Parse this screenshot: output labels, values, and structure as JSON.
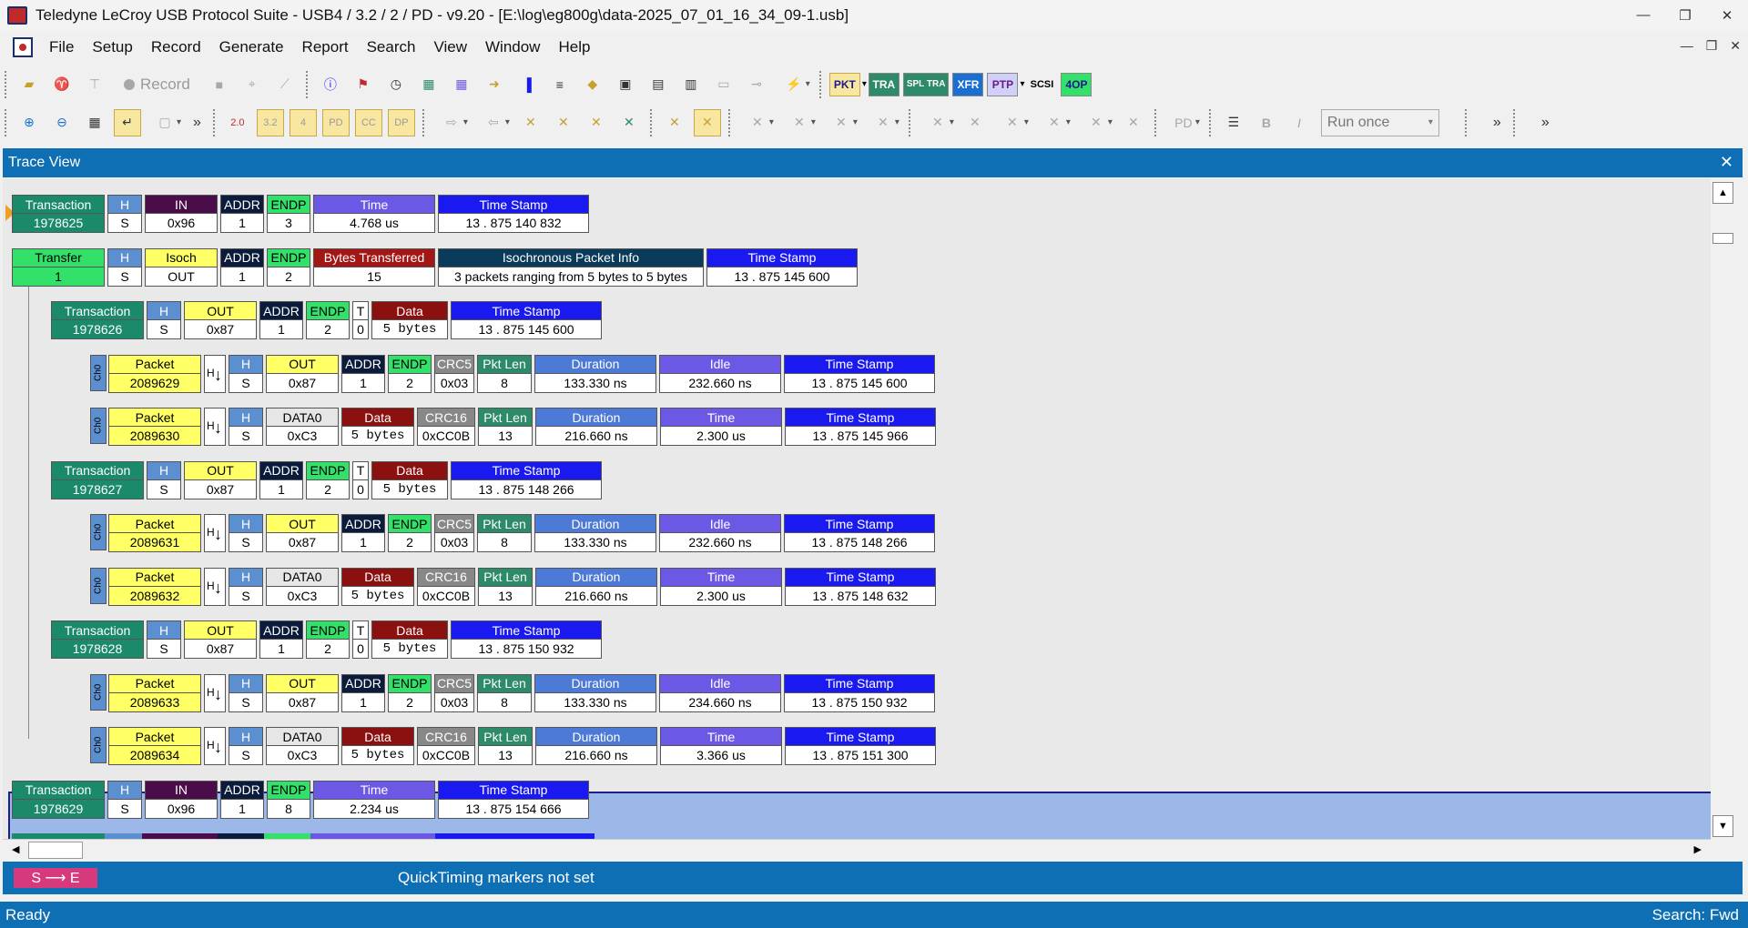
{
  "window": {
    "title": "Teledyne LeCroy USB Protocol Suite - USB4 / 3.2 / 2 / PD - v9.20 - [E:\\log\\eg800g\\data-2025_07_01_16_34_09-1.usb]",
    "min_icon": "minimize-icon",
    "restore_icon": "restore-icon",
    "close_icon": "close-icon"
  },
  "menu": [
    "File",
    "Setup",
    "Record",
    "Generate",
    "Report",
    "Search",
    "View",
    "Window",
    "Help"
  ],
  "toolbar1": {
    "record_label": "Record",
    "protocol_buttons": [
      "PKT",
      "TRA",
      "SPL TRA",
      "XFR",
      "PTP",
      "SCSI",
      "4OP"
    ]
  },
  "toolbar2": {
    "run_mode": "Run once",
    "chevron": "»"
  },
  "trace_view": {
    "title": "Trace View",
    "close": "✕"
  },
  "quicktiming": {
    "se_label": "S ⟶ E",
    "message": "QuickTiming markers not set"
  },
  "status": {
    "left": "Ready",
    "right": "Search: Fwd"
  },
  "rows": [
    {
      "kind": "transaction",
      "indent": 0,
      "cells": [
        {
          "c": "c-trans",
          "h": "Transaction",
          "v": "1978625",
          "w": 102
        },
        {
          "c": "c-hs",
          "h": "H",
          "v": "S",
          "w": 38
        },
        {
          "c": "c-in",
          "h": "IN",
          "v": "0x96",
          "w": 80
        },
        {
          "c": "c-addr",
          "h": "ADDR",
          "v": "1",
          "w": 48
        },
        {
          "c": "c-endp",
          "h": "ENDP",
          "v": "3",
          "w": 48
        },
        {
          "c": "c-time",
          "h": "Time",
          "v": "4.768 us",
          "w": 134
        },
        {
          "c": "c-ts",
          "h": "Time Stamp",
          "v": "13 . 875 140 832",
          "w": 166
        }
      ]
    },
    {
      "kind": "transfer",
      "indent": 0,
      "cells": [
        {
          "c": "c-xfer",
          "h": "Transfer",
          "v": "1",
          "w": 102
        },
        {
          "c": "c-hs",
          "h": "H",
          "v": "S",
          "w": 38
        },
        {
          "c": "c-isoch",
          "h": "Isoch",
          "v": "OUT",
          "w": 80
        },
        {
          "c": "c-addr",
          "h": "ADDR",
          "v": "1",
          "w": 48
        },
        {
          "c": "c-endp",
          "h": "ENDP",
          "v": "2",
          "w": 48
        },
        {
          "c": "c-bytes",
          "h": "Bytes Transferred",
          "v": "15",
          "w": 134
        },
        {
          "c": "c-isoinfo",
          "h": "Isochronous Packet Info",
          "v": "3 packets ranging from 5 bytes to 5 bytes",
          "w": 292
        },
        {
          "c": "c-ts",
          "h": "Time Stamp",
          "v": "13 . 875 145 600",
          "w": 166
        }
      ]
    },
    {
      "kind": "transaction",
      "indent": 1,
      "cells": [
        {
          "c": "c-trans",
          "h": "Transaction",
          "v": "1978626",
          "w": 102
        },
        {
          "c": "c-hs",
          "h": "H",
          "v": "S",
          "w": 38
        },
        {
          "c": "c-out",
          "h": "OUT",
          "v": "0x87",
          "w": 80
        },
        {
          "c": "c-addr",
          "h": "ADDR",
          "v": "1",
          "w": 48
        },
        {
          "c": "c-endp",
          "h": "ENDP",
          "v": "2",
          "w": 48
        },
        {
          "c": "c-t",
          "h": "T",
          "v": "0",
          "w": 18
        },
        {
          "c": "c-data",
          "h": "Data",
          "v": "5 bytes",
          "w": 84,
          "mono": true
        },
        {
          "c": "c-ts",
          "h": "Time Stamp",
          "v": "13 . 875 145 600",
          "w": 166
        }
      ]
    },
    {
      "kind": "packet",
      "indent": 2,
      "ch": "Ch0",
      "cells": [
        {
          "c": "c-pkt",
          "h": "Packet",
          "v": "2089629",
          "w": 102
        },
        {
          "c": "c-hs",
          "h": "H",
          "v": "S",
          "w": 38
        },
        {
          "c": "c-out",
          "h": "OUT",
          "v": "0x87",
          "w": 80
        },
        {
          "c": "c-addr",
          "h": "ADDR",
          "v": "1",
          "w": 48
        },
        {
          "c": "c-endp",
          "h": "ENDP",
          "v": "2",
          "w": 48
        },
        {
          "c": "c-crc5",
          "h": "CRC5",
          "v": "0x03",
          "w": 44
        },
        {
          "c": "c-pktlen",
          "h": "Pkt Len",
          "v": "8",
          "w": 60
        },
        {
          "c": "c-dur",
          "h": "Duration",
          "v": "133.330 ns",
          "w": 134
        },
        {
          "c": "c-idle",
          "h": "Idle",
          "v": "232.660 ns",
          "w": 134
        },
        {
          "c": "c-ts",
          "h": "Time Stamp",
          "v": "13 . 875 145 600",
          "w": 166
        }
      ]
    },
    {
      "kind": "packet",
      "indent": 2,
      "ch": "Ch0",
      "cells": [
        {
          "c": "c-pkt",
          "h": "Packet",
          "v": "2089630",
          "w": 102
        },
        {
          "c": "c-hs",
          "h": "H",
          "v": "S",
          "w": 38
        },
        {
          "c": "c-data0",
          "h": "DATA0",
          "v": "0xC3",
          "w": 80
        },
        {
          "c": "c-data",
          "h": "Data",
          "v": "5 bytes",
          "w": 80,
          "mono": true
        },
        {
          "c": "c-crc16",
          "h": "CRC16",
          "v": "0xCC0B",
          "w": 64
        },
        {
          "c": "c-pktlen",
          "h": "Pkt Len",
          "v": "13",
          "w": 60
        },
        {
          "c": "c-dur",
          "h": "Duration",
          "v": "216.660 ns",
          "w": 134
        },
        {
          "c": "c-time",
          "h": "Time",
          "v": "2.300 us",
          "w": 134
        },
        {
          "c": "c-ts",
          "h": "Time Stamp",
          "v": "13 . 875 145 966",
          "w": 166
        }
      ]
    },
    {
      "kind": "transaction",
      "indent": 1,
      "cells": [
        {
          "c": "c-trans",
          "h": "Transaction",
          "v": "1978627",
          "w": 102
        },
        {
          "c": "c-hs",
          "h": "H",
          "v": "S",
          "w": 38
        },
        {
          "c": "c-out",
          "h": "OUT",
          "v": "0x87",
          "w": 80
        },
        {
          "c": "c-addr",
          "h": "ADDR",
          "v": "1",
          "w": 48
        },
        {
          "c": "c-endp",
          "h": "ENDP",
          "v": "2",
          "w": 48
        },
        {
          "c": "c-t",
          "h": "T",
          "v": "0",
          "w": 18
        },
        {
          "c": "c-data",
          "h": "Data",
          "v": "5 bytes",
          "w": 84,
          "mono": true
        },
        {
          "c": "c-ts",
          "h": "Time Stamp",
          "v": "13 . 875 148 266",
          "w": 166
        }
      ]
    },
    {
      "kind": "packet",
      "indent": 2,
      "ch": "Ch0",
      "cells": [
        {
          "c": "c-pkt",
          "h": "Packet",
          "v": "2089631",
          "w": 102
        },
        {
          "c": "c-hs",
          "h": "H",
          "v": "S",
          "w": 38
        },
        {
          "c": "c-out",
          "h": "OUT",
          "v": "0x87",
          "w": 80
        },
        {
          "c": "c-addr",
          "h": "ADDR",
          "v": "1",
          "w": 48
        },
        {
          "c": "c-endp",
          "h": "ENDP",
          "v": "2",
          "w": 48
        },
        {
          "c": "c-crc5",
          "h": "CRC5",
          "v": "0x03",
          "w": 44
        },
        {
          "c": "c-pktlen",
          "h": "Pkt Len",
          "v": "8",
          "w": 60
        },
        {
          "c": "c-dur",
          "h": "Duration",
          "v": "133.330 ns",
          "w": 134
        },
        {
          "c": "c-idle",
          "h": "Idle",
          "v": "232.660 ns",
          "w": 134
        },
        {
          "c": "c-ts",
          "h": "Time Stamp",
          "v": "13 . 875 148 266",
          "w": 166
        }
      ]
    },
    {
      "kind": "packet",
      "indent": 2,
      "ch": "Ch0",
      "cells": [
        {
          "c": "c-pkt",
          "h": "Packet",
          "v": "2089632",
          "w": 102
        },
        {
          "c": "c-hs",
          "h": "H",
          "v": "S",
          "w": 38
        },
        {
          "c": "c-data0",
          "h": "DATA0",
          "v": "0xC3",
          "w": 80
        },
        {
          "c": "c-data",
          "h": "Data",
          "v": "5 bytes",
          "w": 80,
          "mono": true
        },
        {
          "c": "c-crc16",
          "h": "CRC16",
          "v": "0xCC0B",
          "w": 64
        },
        {
          "c": "c-pktlen",
          "h": "Pkt Len",
          "v": "13",
          "w": 60
        },
        {
          "c": "c-dur",
          "h": "Duration",
          "v": "216.660 ns",
          "w": 134
        },
        {
          "c": "c-time",
          "h": "Time",
          "v": "2.300 us",
          "w": 134
        },
        {
          "c": "c-ts",
          "h": "Time Stamp",
          "v": "13 . 875 148 632",
          "w": 166
        }
      ]
    },
    {
      "kind": "transaction",
      "indent": 1,
      "selected": true,
      "cells": [
        {
          "c": "c-trans",
          "h": "Transaction",
          "v": "1978628",
          "w": 102
        },
        {
          "c": "c-hs",
          "h": "H",
          "v": "S",
          "w": 38
        },
        {
          "c": "c-out",
          "h": "OUT",
          "v": "0x87",
          "w": 80
        },
        {
          "c": "c-addr",
          "h": "ADDR",
          "v": "1",
          "w": 48
        },
        {
          "c": "c-endp",
          "h": "ENDP",
          "v": "2",
          "w": 48
        },
        {
          "c": "c-t",
          "h": "T",
          "v": "0",
          "w": 18
        },
        {
          "c": "c-data",
          "h": "Data",
          "v": "5 bytes",
          "w": 84,
          "mono": true
        },
        {
          "c": "c-ts",
          "h": "Time Stamp",
          "v": "13 . 875 150 932",
          "w": 166
        }
      ]
    },
    {
      "kind": "packet",
      "indent": 2,
      "ch": "Ch0",
      "cells": [
        {
          "c": "c-pkt",
          "h": "Packet",
          "v": "2089633",
          "w": 102
        },
        {
          "c": "c-hs",
          "h": "H",
          "v": "S",
          "w": 38
        },
        {
          "c": "c-out",
          "h": "OUT",
          "v": "0x87",
          "w": 80
        },
        {
          "c": "c-addr",
          "h": "ADDR",
          "v": "1",
          "w": 48
        },
        {
          "c": "c-endp",
          "h": "ENDP",
          "v": "2",
          "w": 48
        },
        {
          "c": "c-crc5",
          "h": "CRC5",
          "v": "0x03",
          "w": 44
        },
        {
          "c": "c-pktlen",
          "h": "Pkt Len",
          "v": "8",
          "w": 60
        },
        {
          "c": "c-dur",
          "h": "Duration",
          "v": "133.330 ns",
          "w": 134
        },
        {
          "c": "c-idle",
          "h": "Idle",
          "v": "234.660 ns",
          "w": 134
        },
        {
          "c": "c-ts",
          "h": "Time Stamp",
          "v": "13 . 875 150 932",
          "w": 166
        }
      ]
    },
    {
      "kind": "packet",
      "indent": 2,
      "ch": "Ch0",
      "cells": [
        {
          "c": "c-pkt",
          "h": "Packet",
          "v": "2089634",
          "w": 102
        },
        {
          "c": "c-hs",
          "h": "H",
          "v": "S",
          "w": 38
        },
        {
          "c": "c-data0",
          "h": "DATA0",
          "v": "0xC3",
          "w": 80
        },
        {
          "c": "c-data",
          "h": "Data",
          "v": "5 bytes",
          "w": 80,
          "mono": true
        },
        {
          "c": "c-crc16",
          "h": "CRC16",
          "v": "0xCC0B",
          "w": 64
        },
        {
          "c": "c-pktlen",
          "h": "Pkt Len",
          "v": "13",
          "w": 60
        },
        {
          "c": "c-dur",
          "h": "Duration",
          "v": "216.660 ns",
          "w": 134
        },
        {
          "c": "c-time",
          "h": "Time",
          "v": "3.366 us",
          "w": 134
        },
        {
          "c": "c-ts",
          "h": "Time Stamp",
          "v": "13 . 875 151 300",
          "w": 166
        }
      ]
    },
    {
      "kind": "transaction",
      "indent": 0,
      "cells": [
        {
          "c": "c-trans",
          "h": "Transaction",
          "v": "1978629",
          "w": 102
        },
        {
          "c": "c-hs",
          "h": "H",
          "v": "S",
          "w": 38
        },
        {
          "c": "c-in",
          "h": "IN",
          "v": "0x96",
          "w": 80
        },
        {
          "c": "c-addr",
          "h": "ADDR",
          "v": "1",
          "w": 48
        },
        {
          "c": "c-endp",
          "h": "ENDP",
          "v": "8",
          "w": 48
        },
        {
          "c": "c-time",
          "h": "Time",
          "v": "2.234 us",
          "w": 134
        },
        {
          "c": "c-ts",
          "h": "Time Stamp",
          "v": "13 . 875 154 666",
          "w": 166
        }
      ]
    }
  ]
}
